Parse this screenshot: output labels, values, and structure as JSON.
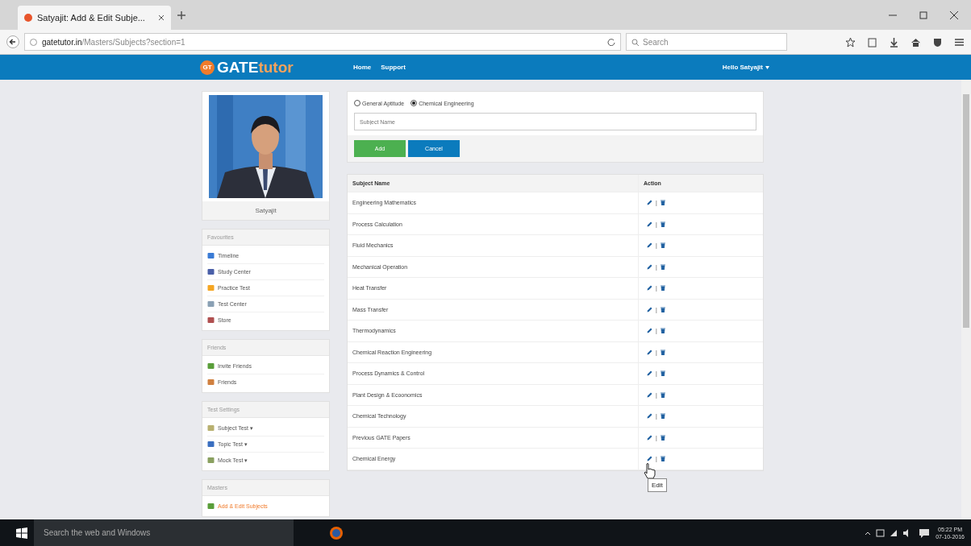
{
  "browser": {
    "tab_title": "Satyajit: Add & Edit Subje...",
    "url_domain": "gatetutor.in",
    "url_path": "/Masters/Subjects?section=1",
    "search_placeholder": "Search"
  },
  "nav": {
    "logo_badge": "GT",
    "logo_word": "GATE",
    "logo_suffix": "tutor",
    "links": [
      "Home",
      "Support"
    ],
    "user": "Hello Satyajit"
  },
  "profile": {
    "name": "Satyajit"
  },
  "sidebar": [
    {
      "title": "Favourites",
      "items": [
        {
          "label": "Timeline",
          "selected": false
        },
        {
          "label": "Study Center",
          "selected": false
        },
        {
          "label": "Practice Test",
          "selected": false
        },
        {
          "label": "Test Center",
          "selected": false
        },
        {
          "label": "Store",
          "selected": false
        }
      ]
    },
    {
      "title": "Friends",
      "items": [
        {
          "label": "Invite Friends",
          "selected": false
        },
        {
          "label": "Friends",
          "selected": false
        }
      ]
    },
    {
      "title": "Test Settings",
      "items": [
        {
          "label": "Subject Test ▾",
          "selected": false
        },
        {
          "label": "Topic Test ▾",
          "selected": false
        },
        {
          "label": "Mock Test ▾",
          "selected": false
        }
      ]
    },
    {
      "title": "Masters",
      "items": [
        {
          "label": "Add & Edit Subjects",
          "selected": true
        }
      ]
    }
  ],
  "form": {
    "radios": [
      {
        "label": "General Aptitude",
        "selected": false
      },
      {
        "label": "Chemical Engineering",
        "selected": true
      }
    ],
    "placeholder": "Subject Name",
    "buttons": [
      {
        "label": "Add",
        "kind": "primary"
      },
      {
        "label": "Cancel",
        "kind": "secondary"
      }
    ]
  },
  "table": {
    "columns": [
      "Subject Name",
      "Action"
    ],
    "rows": [
      {
        "name": "Engineering Mathematics",
        "separator": "|"
      },
      {
        "name": "Process Calculation",
        "separator": "|"
      },
      {
        "name": "Fluid Mechanics",
        "separator": "|"
      },
      {
        "name": "Mechanical Operation",
        "separator": "|"
      },
      {
        "name": "Heat Transfer",
        "separator": "|"
      },
      {
        "name": "Mass Transfer",
        "separator": "|"
      },
      {
        "name": "Thermodynamics",
        "separator": "|"
      },
      {
        "name": "Chemical Reaction Engineering",
        "separator": "|"
      },
      {
        "name": "Process Dynamics & Control",
        "separator": "|"
      },
      {
        "name": "Plant Design & Ecoonomics",
        "separator": "|"
      },
      {
        "name": "Chemical Technology",
        "separator": "|"
      },
      {
        "name": "Previous GATE Papers",
        "separator": "|"
      },
      {
        "name": "Chemical Energy",
        "separator": "|"
      }
    ]
  },
  "tooltip": "Edit",
  "taskbar": {
    "search_placeholder": "Search the web and Windows",
    "time": "05:22 PM",
    "date": "07-10-2016"
  }
}
